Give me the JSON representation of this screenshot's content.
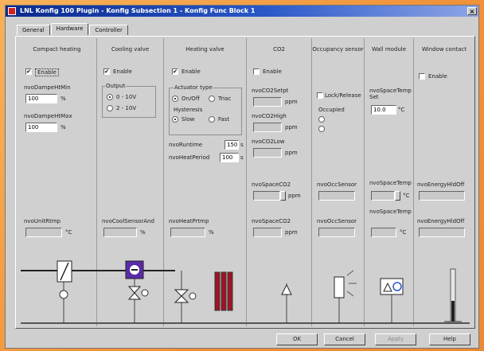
{
  "window": {
    "title": "LNL Konfig 100 Plugin - Konfig Subsection 1 - Konfig Func Block 1",
    "close_label": "×"
  },
  "tabs": [
    {
      "label": "General"
    },
    {
      "label": "Hardware"
    },
    {
      "label": "Controller"
    }
  ],
  "columns": {
    "compact_heating": {
      "title": "Compact heating",
      "enable_label": "Enable",
      "enable_checked": true,
      "min_label": "nvoDampeHtMin",
      "min_value": "100",
      "min_unit": "%",
      "max_label": "nvoDampeHtMax",
      "max_value": "100",
      "max_unit": "%",
      "bottom_label": "nvoUnitRtmp",
      "bottom_unit": "°C"
    },
    "cooling_valve": {
      "title": "Cooling valve",
      "enable_label": "Enable",
      "enable_checked": true,
      "output_label": "Output",
      "radio1": "0 - 10V",
      "radio2": "2 - 10V",
      "bottom_label": "nvoCoolSensorAnd",
      "bottom_unit": "%"
    },
    "heating_valve": {
      "title": "Heating valve",
      "enable_label": "Enable",
      "enable_checked": true,
      "actuator_label": "Actuator type",
      "opt1": "On/Off",
      "opt2": "Triac",
      "hysteresis_label": "Hysteresis",
      "opt3": "Slow",
      "opt4": "Fast",
      "runtime_label": "nvoRuntime",
      "runtime_value": "150",
      "runtime_unit": "s",
      "pwm_label": "nvoHeatPeriod",
      "pwm_value": "100",
      "pwm_unit": "s",
      "bottom_label": "nvoHeatPrtmp",
      "bottom_unit": "%"
    },
    "co2": {
      "title": "CO2",
      "enable_label": "Enable",
      "field1_label": "nvoCO2Setpt",
      "field1_unit": "ppm",
      "field2_label": "nvoCO2High",
      "field2_unit": "ppm",
      "field3_label": "nvoCO2Low",
      "field3_unit": "ppm",
      "field4_label": "nvoSpaceCO2",
      "field4_unit": "ppm",
      "bottom_label": "nvoSpaceCO2",
      "bottom_unit": "ppm"
    },
    "occupancy": {
      "title": "Occupancy sensor",
      "enable_label": "Lock/Release",
      "sensor_label": "Occupied",
      "field_label": "nvoOccSensor",
      "bottom_label": "nvoOccSensor"
    },
    "wall_module": {
      "title": "Wall module",
      "temp_label": "nvoSpaceTemp Set",
      "temp_value": "10.0",
      "temp_unit": "°C",
      "space_label": "nvoSpaceTemp",
      "space_unit": "°C",
      "bottom_label": "nvoSpaceTemp",
      "bottom_unit": "°C"
    },
    "window": {
      "title": "Window contact",
      "enable_label": "Enable",
      "field_label": "nvoEnergyHldOff",
      "bottom_label": "nvoEnergyHldOff"
    }
  },
  "buttons": {
    "ok": "OK",
    "cancel": "Cancel",
    "apply": "Apply",
    "help": "Help"
  },
  "colors": {
    "accent_purple": "#5a2aa8",
    "pipe_red": "#a01424",
    "title_blue": "#0a2a8c"
  }
}
